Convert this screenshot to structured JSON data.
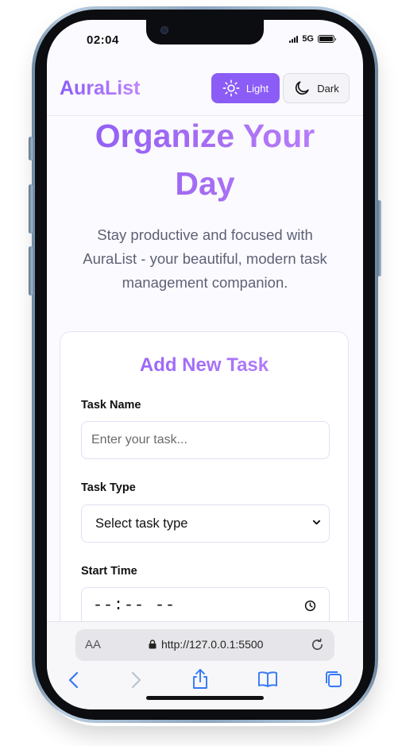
{
  "status": {
    "time": "02:04",
    "network": "5G"
  },
  "header": {
    "brand": "AuraList",
    "light_label": "Light",
    "dark_label": "Dark"
  },
  "hero": {
    "title_line1": "Organize Your",
    "title_line2": "Day",
    "subtitle": "Stay productive and focused with AuraList - your beautiful, modern task management companion."
  },
  "form": {
    "title": "Add New Task",
    "task_name_label": "Task Name",
    "task_name_placeholder": "Enter your task...",
    "task_type_label": "Task Type",
    "task_type_selected": "Select task type",
    "start_time_label": "Start Time",
    "start_time_value": "--:-- --"
  },
  "browser": {
    "aa_label": "AA",
    "url": "http://127.0.0.1:5500"
  },
  "colors": {
    "accent": "#8b5cf6",
    "accent_light": "#c084fc",
    "text_muted": "#5d6175"
  }
}
